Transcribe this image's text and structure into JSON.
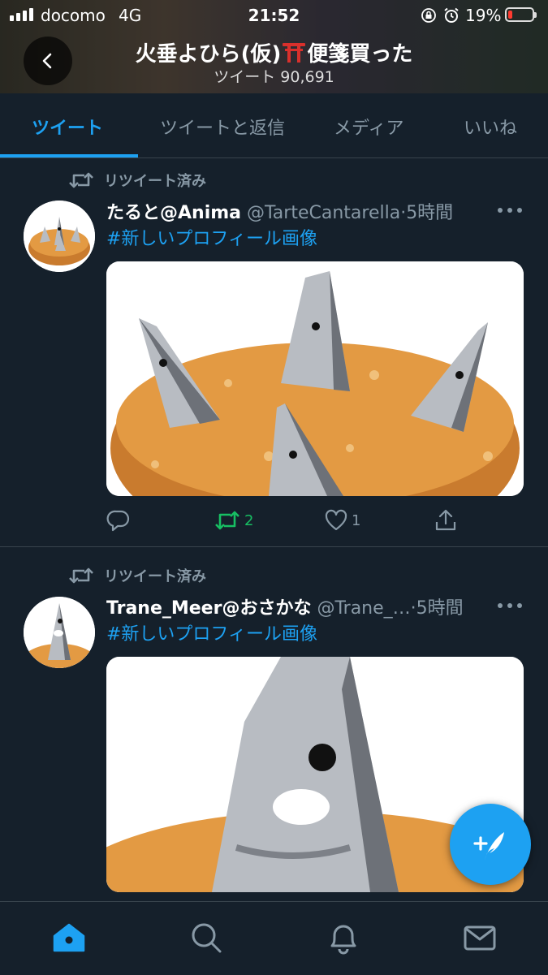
{
  "status_bar": {
    "carrier": "docomo",
    "network": "4G",
    "time": "21:52",
    "battery": "19%",
    "battery_level": 0.19,
    "battery_color": "#ff3b30"
  },
  "header": {
    "name_before": "火垂よひら(仮)",
    "name_after": "便箋買った",
    "tweet_count": "ツイート 90,691"
  },
  "tabs": [
    {
      "label": "ツイート",
      "active": true
    },
    {
      "label": "ツイートと返信",
      "active": false
    },
    {
      "label": "メディア",
      "active": false
    },
    {
      "label": "いいね",
      "active": false
    }
  ],
  "tweets": [
    {
      "retweet_label": "リツイート済み",
      "name": "たると@Anima",
      "handle": "@TarteCantarella",
      "time": "5時間",
      "text": "#新しいプロフィール画像",
      "retweets": "2",
      "likes": "1"
    },
    {
      "retweet_label": "リツイート済み",
      "name": "Trane_Meer@おさかな",
      "handle": "@Trane_…",
      "time": "5時間",
      "text": "#新しいプロフィール画像"
    }
  ],
  "colors": {
    "background": "#15202b",
    "accent": "#1da1f2",
    "retweet_green": "#17bf63",
    "muted": "#8899a6"
  },
  "icons": {
    "back": "chevron-left-icon",
    "retweet": "retweet-icon",
    "reply": "reply-icon",
    "like": "heart-icon",
    "share": "share-icon",
    "more": "more-icon",
    "compose": "compose-tweet-icon",
    "nav": [
      "home-icon",
      "search-icon",
      "notifications-icon",
      "messages-icon"
    ]
  }
}
